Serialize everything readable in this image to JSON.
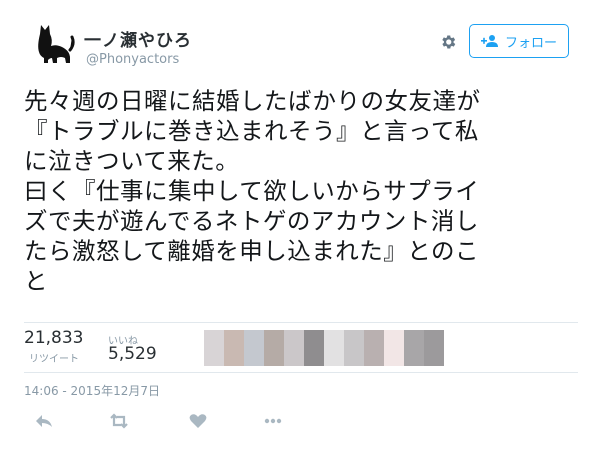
{
  "user": {
    "display_name": "一ノ瀬やひろ",
    "screen_name": "@Phonyactors"
  },
  "follow_button": {
    "label": "フォロー",
    "icon": "add-user-icon"
  },
  "settings_icon": "gear-icon",
  "tweet": {
    "lines": [
      "先々週の日曜に結婚したばかりの女友達が",
      "『トラブルに巻き込まれそう』と言って私",
      "に泣きついて来た。",
      "曰く『仕事に集中して欲しいからサプライ",
      "ズで夫が遊んでるネトゲのアカウント消し",
      "たら激怒して離婚を申し込まれた』とのこ",
      "と"
    ]
  },
  "stats": {
    "retweets": {
      "count": "21,833",
      "label": "リツイート"
    },
    "likes": {
      "count": "5,529",
      "label": "いいね"
    }
  },
  "liker_avatars": {
    "colors": [
      "#d8d4d6",
      "#c9b9b2",
      "#c4c8cf",
      "#b5aba6",
      "#cbc7c9",
      "#8f8d8f",
      "#e2e1e2",
      "#c8c6c8",
      "#b9b0b0",
      "#f2e6e6",
      "#a8a6a8",
      "#9c9a9c"
    ]
  },
  "timestamp": "14:06 - 2015年12月7日",
  "actions": [
    "reply-icon",
    "retweet-icon",
    "like-icon",
    "more-icon"
  ],
  "colors": {
    "accent": "#1da1f2",
    "text": "#14171a",
    "muted": "#8899a6",
    "border": "#e1e8ed"
  }
}
